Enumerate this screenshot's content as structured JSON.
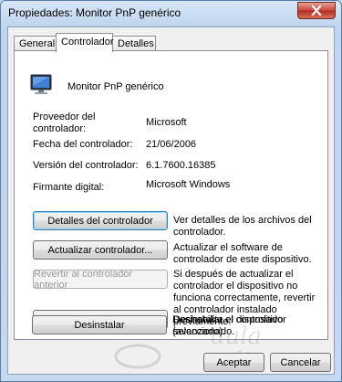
{
  "window": {
    "title": "Propiedades: Monitor PnP genérico"
  },
  "tabs": [
    {
      "label": "General"
    },
    {
      "label": "Controlador"
    },
    {
      "label": "Detalles"
    }
  ],
  "device": {
    "name": "Monitor PnP genérico",
    "icon": "monitor-icon"
  },
  "info": {
    "provider_label": "Proveedor del controlador:",
    "provider_value": "Microsoft",
    "date_label": "Fecha del controlador:",
    "date_value": "21/06/2006",
    "version_label": "Versión del controlador:",
    "version_value": "6.1.7600.16385",
    "signer_label": "Firmante digital:",
    "signer_value": "Microsoft Windows"
  },
  "actions": [
    {
      "button": "Detalles del controlador",
      "description": "Ver detalles de los archivos del controlador."
    },
    {
      "button": "Actualizar controlador...",
      "description": "Actualizar el software de controlador de este dispositivo."
    },
    {
      "button": "Revertir al controlador anterior",
      "description": "Si después de actualizar el controlador el dispositivo no funciona correctamente, revertir al controlador instalado previamente."
    },
    {
      "button": "Deshabilitar",
      "description": "Deshabilita el dispositivo seleccionado."
    },
    {
      "button": "Desinstalar",
      "description": "Desinstalar el controlador (avanzado)."
    }
  ],
  "footer": {
    "ok_label": "Aceptar",
    "cancel_label": "Cancelar"
  },
  "watermark": {
    "text": "aula clic"
  },
  "colors": {
    "titlebar": "#c4d8ef",
    "close_button": "#c7463a",
    "focus_border": "#3c7fb1"
  }
}
